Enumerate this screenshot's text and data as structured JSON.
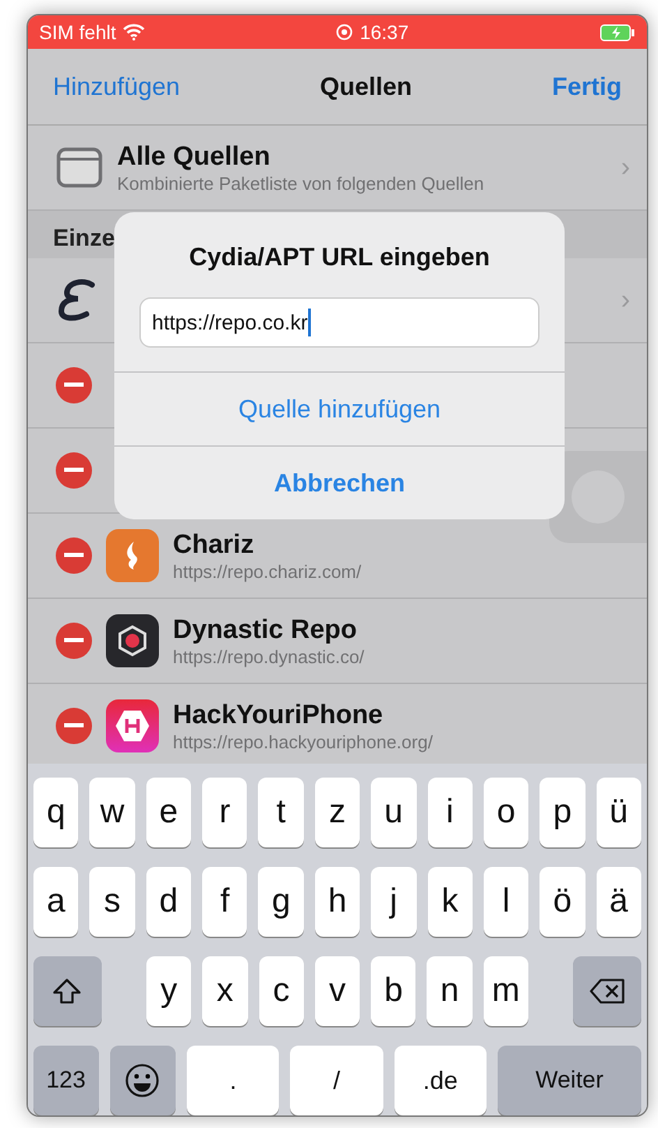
{
  "status_bar": {
    "carrier": "SIM fehlt",
    "time": "16:37",
    "charging": true
  },
  "nav_bar": {
    "left_button": "Hinzufügen",
    "title": "Quellen",
    "right_button": "Fertig"
  },
  "all_sources": {
    "title": "Alle Quellen",
    "subtitle": "Kombinierte Paketliste von folgenden Quellen",
    "chevron": "›"
  },
  "section_header": "Einze",
  "sources": [
    {
      "kind": "featured",
      "chevron": "›",
      "deletable": false
    },
    {
      "kind": "plain",
      "deletable": true
    },
    {
      "kind": "plain",
      "deletable": true
    },
    {
      "kind": "chariz",
      "name": "Chariz",
      "url": "https://repo.chariz.com/",
      "deletable": true
    },
    {
      "kind": "dynastic",
      "name": "Dynastic Repo",
      "url": "https://repo.dynastic.co/",
      "deletable": true
    },
    {
      "kind": "hyi",
      "name": "HackYouriPhone",
      "url": "https://repo.hackyouriphone.org/",
      "deletable": true
    }
  ],
  "dialog": {
    "title": "Cydia/APT URL eingeben",
    "value": "https://repo.co.kr",
    "buttons": [
      {
        "label": "Quelle hinzufügen",
        "bold": false
      },
      {
        "label": "Abbrechen",
        "bold": true
      }
    ]
  },
  "keyboard": {
    "top_row": [
      "q",
      "w",
      "e",
      "r",
      "t",
      "z",
      "u",
      "i",
      "o",
      "p",
      "ü"
    ],
    "middle_row": [
      "a",
      "s",
      "d",
      "f",
      "g",
      "h",
      "j",
      "k",
      "l",
      "ö",
      "ä"
    ],
    "bottom_row": [
      "y",
      "x",
      "c",
      "v",
      "b",
      "n",
      "m"
    ],
    "function_row": [
      {
        "label": "123",
        "kind": "mode"
      },
      {
        "kind": "emoji"
      },
      {
        "label": ".",
        "kind": "wide"
      },
      {
        "label": "/",
        "kind": "wide"
      },
      {
        "label": ".de",
        "kind": "wide"
      },
      {
        "label": "Weiter",
        "kind": "action"
      }
    ]
  }
}
